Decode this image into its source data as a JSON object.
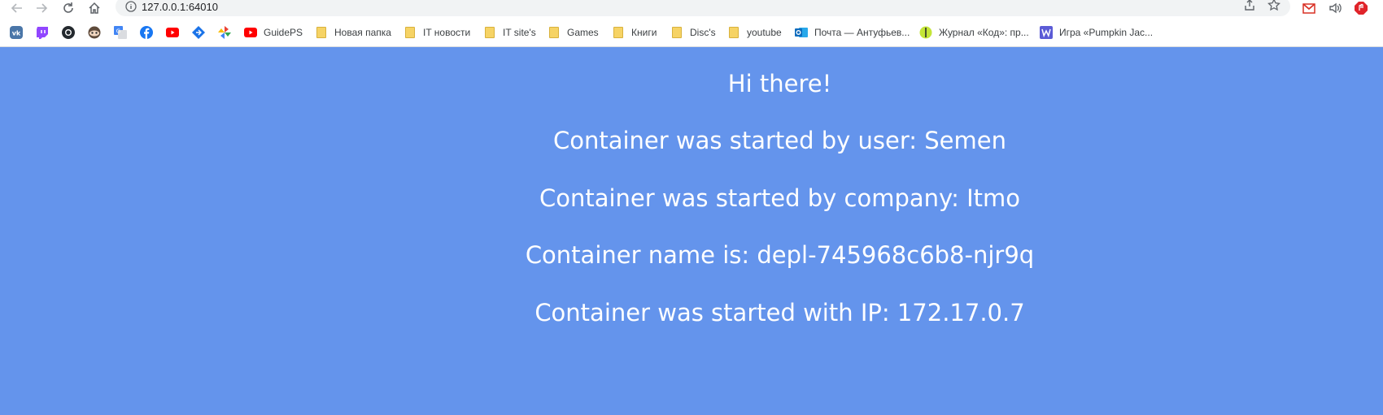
{
  "browser": {
    "url": "127.0.0.1:64010",
    "icons": {
      "back": "arrow-left-icon",
      "forward": "arrow-right-icon",
      "reload": "reload-icon",
      "home": "home-icon",
      "info": "info-icon",
      "share": "share-icon",
      "star": "star-icon"
    }
  },
  "bookmarks": [
    {
      "label": "",
      "icon": "vk-icon",
      "color": "#4a76a8"
    },
    {
      "label": "",
      "icon": "twitch-icon",
      "color": "#9146ff"
    },
    {
      "label": "",
      "icon": "github-icon",
      "color": "#24292e"
    },
    {
      "label": "",
      "icon": "mask-icon",
      "color": "#5f4b3b"
    },
    {
      "label": "",
      "icon": "translate-icon",
      "color": "#4285f4"
    },
    {
      "label": "",
      "icon": "facebook-icon",
      "color": "#1877f2"
    },
    {
      "label": "",
      "icon": "youtube-icon",
      "color": "#ff0000"
    },
    {
      "label": "",
      "icon": "diamond-icon",
      "color": "#1a73e8"
    },
    {
      "label": "",
      "icon": "pinwheel-icon",
      "color": "#34a853"
    },
    {
      "label": "GuidePS",
      "icon": "youtube-icon",
      "color": "#ff0000"
    },
    {
      "label": "Новая папка",
      "icon": "folder-icon",
      "color": "#f6d365"
    },
    {
      "label": "IT новости",
      "icon": "folder-icon",
      "color": "#f6d365"
    },
    {
      "label": "IT site's",
      "icon": "folder-icon",
      "color": "#f6d365"
    },
    {
      "label": "Games",
      "icon": "folder-icon",
      "color": "#f6d365"
    },
    {
      "label": "Книги",
      "icon": "folder-icon",
      "color": "#f6d365"
    },
    {
      "label": "Disc's",
      "icon": "folder-icon",
      "color": "#f6d365"
    },
    {
      "label": "youtube",
      "icon": "folder-icon",
      "color": "#f6d365"
    },
    {
      "label": "Почта — Антуфьев...",
      "icon": "outlook-icon",
      "color": "#0f6cbd"
    },
    {
      "label": "Журнал «Код»: пр...",
      "icon": "kod-icon",
      "color": "#c4e538"
    },
    {
      "label": "Игра «Pumpkin Jac...",
      "icon": "w-icon",
      "color": "#5b5bd6"
    }
  ],
  "extensions": [
    {
      "icon": "gmail-icon",
      "color": "#d93025"
    },
    {
      "icon": "speaker-icon",
      "color": "#5f6368"
    },
    {
      "icon": "adblock-icon",
      "color": "#e0242a"
    }
  ],
  "content": {
    "greeting": "Hi there!",
    "user_line": "Container was started by user: Semen",
    "company_line": "Container was started by company: Itmo",
    "name_line": "Container name is: depl-745968c6b8-njr9q",
    "ip_line": "Container was started with IP: 172.17.0.7"
  },
  "colors": {
    "page_background": "#6494ec",
    "text": "#ffffff"
  }
}
